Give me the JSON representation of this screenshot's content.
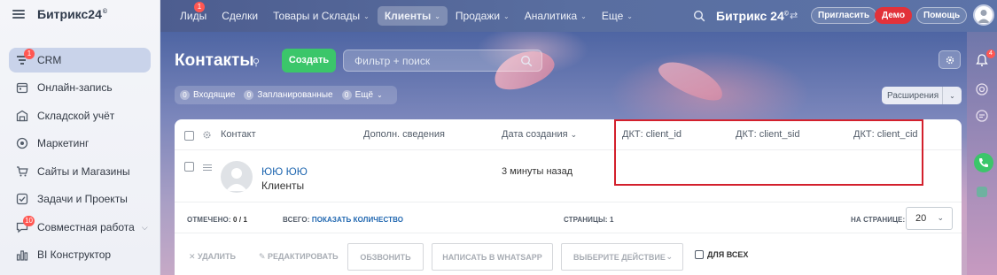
{
  "app": {
    "logo": "Битрикс24",
    "logo_mark": "©"
  },
  "sidebar": {
    "items": [
      {
        "label": "CRM",
        "icon": "funnel-icon",
        "badge": "1",
        "active": true
      },
      {
        "label": "Онлайн-запись",
        "icon": "calendar-icon"
      },
      {
        "label": "Складской учёт",
        "icon": "warehouse-icon"
      },
      {
        "label": "Маркетинг",
        "icon": "target-icon"
      },
      {
        "label": "Сайты и Магазины",
        "icon": "cart-icon"
      },
      {
        "label": "Задачи и Проекты",
        "icon": "checkbox-icon"
      },
      {
        "label": "Совместная работа",
        "icon": "chat-icon",
        "badge": "10",
        "has_chevron": true
      },
      {
        "label": "BI Конструктор",
        "icon": "bar-chart-icon"
      }
    ]
  },
  "topnav": {
    "items": [
      {
        "label": "Лиды",
        "badge": "1"
      },
      {
        "label": "Сделки"
      },
      {
        "label": "Товары и Склады",
        "dropdown": true
      },
      {
        "label": "Клиенты",
        "dropdown": true,
        "active": true
      },
      {
        "label": "Продажи",
        "dropdown": true
      },
      {
        "label": "Аналитика",
        "dropdown": true
      },
      {
        "label": "Еще",
        "dropdown": true
      }
    ],
    "brand": "Битрикс 24",
    "invite_label": "Пригласить",
    "demo_label": "Демо",
    "help_label": "Помощь"
  },
  "page": {
    "title": "Контакты",
    "create_label": "Создать",
    "filter_placeholder": "Фильтр + поиск",
    "counters": [
      {
        "count": "0",
        "label": "Входящие"
      },
      {
        "count": "0",
        "label": "Запланированные"
      },
      {
        "count": "0",
        "label": "Ещё"
      }
    ],
    "extensions_label": "Расширения"
  },
  "grid": {
    "columns": [
      "Контакт",
      "Дополн. сведения",
      "Дата создания",
      "ДКТ: client_id",
      "ДКТ: client_sid",
      "ДКТ: client_cid"
    ],
    "rows": [
      {
        "name": "ЮЮ ЮЮ",
        "type": "Клиенты",
        "created": "3 минуты назад",
        "client_id": "",
        "client_sid": "",
        "client_cid": ""
      }
    ],
    "footer": {
      "marked_label": "ОТМЕЧЕНО:",
      "marked_value": "0 / 1",
      "total_label": "ВСЕГО:",
      "total_link": "ПОКАЗАТЬ КОЛИЧЕСТВО",
      "pages_label": "СТРАНИЦЫ:",
      "pages_value": "1",
      "per_page_label": "НА СТРАНИЦЕ:",
      "per_page_value": "20"
    },
    "actions": {
      "delete": "УДАЛИТЬ",
      "edit": "РЕДАКТИРОВАТЬ",
      "call": "ОБЗВОНИТЬ",
      "whatsapp": "НАПИСАТЬ В WHATSAPP",
      "choose": "ВЫБЕРИТЕ ДЕЙСТВИЕ",
      "for_all": "ДЛЯ ВСЕХ"
    }
  },
  "colors": {
    "create_button": "#3bc66a",
    "demo_button": "#e2323a",
    "highlight": "#d3202c",
    "link": "#2067b0",
    "badge": "#ff5752"
  }
}
